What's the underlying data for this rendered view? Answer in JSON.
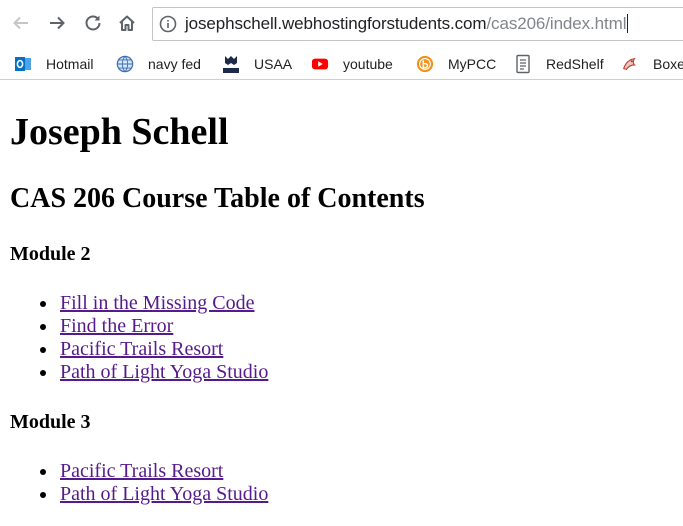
{
  "browser": {
    "url_domain": "josephschell.webhostingforstudents.com",
    "url_path": "/cas206/index.html",
    "buttons": [
      "back-icon",
      "forward-icon",
      "reload-icon",
      "home-icon"
    ]
  },
  "bookmarks": [
    {
      "label": "Hotmail",
      "icon": "outlook-icon"
    },
    {
      "label": "navy fed",
      "icon": "globe-icon"
    },
    {
      "label": "USAA",
      "icon": "usaa-icon"
    },
    {
      "label": "youtube",
      "icon": "youtube-icon"
    },
    {
      "label": "MyPCC",
      "icon": "mypcc-icon"
    },
    {
      "label": "RedShelf",
      "icon": "document-icon"
    },
    {
      "label": "Boxe",
      "icon": "box-logo-icon"
    }
  ],
  "page": {
    "title": "Joseph Schell",
    "subtitle": "CAS 206 Course Table of Contents",
    "modules": [
      {
        "heading": "Module 2",
        "links": [
          "Fill in the Missing Code",
          "Find the Error",
          "Pacific Trails Resort",
          "Path of Light Yoga Studio"
        ]
      },
      {
        "heading": "Module 3",
        "links": [
          "Pacific Trails Resort",
          "Path of Light Yoga Studio"
        ]
      }
    ]
  },
  "colors": {
    "link_visited": "#551a8b",
    "text": "#000000",
    "url_path": "#80868b",
    "youtube": "#ff0000",
    "outlook": "#0072c6",
    "mypcc": "#f0931e"
  }
}
